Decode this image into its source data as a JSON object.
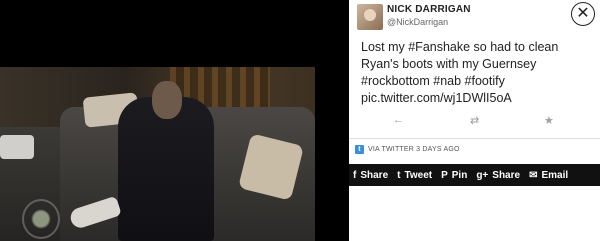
{
  "media": {
    "description_icon": "video-frame"
  },
  "tweet": {
    "user_name": "NICK DARRIGAN",
    "user_handle": "@NickDarrigan",
    "line1": "Lost my #Fanshake so had to clean",
    "line2": "Ryan's boots with my Guernsey",
    "line3": "#rockbottom #nab #footify",
    "line4": "pic.twitter.com/wj1DWlI5oA"
  },
  "actions": {
    "reply_icon": "reply-icon",
    "retweet_icon": "retweet-icon",
    "favorite_icon": "star-icon"
  },
  "source": {
    "text": "VIA TWITTER 3 DAYS AGO"
  },
  "share": [
    {
      "icon": "f",
      "label": "Share"
    },
    {
      "icon": "t",
      "label": "Tweet"
    },
    {
      "icon": "P",
      "label": "Pin"
    },
    {
      "icon": "g+",
      "label": "Share"
    },
    {
      "icon": "✉",
      "label": "Email"
    }
  ],
  "colors": {
    "share_bar": "#111111",
    "twitter_blue": "#3a8fd6"
  }
}
